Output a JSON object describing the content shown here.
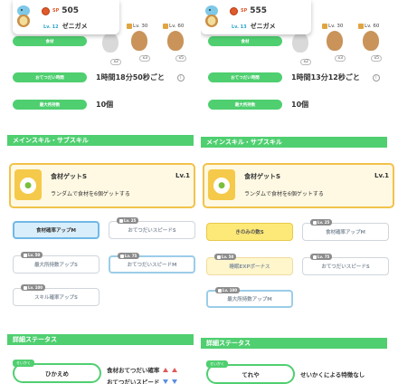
{
  "left": {
    "pokemon": {
      "sp_label": "SP",
      "sp_value": "505",
      "lv": "Lv. 12",
      "name": "ゼニガメ"
    },
    "ingredients": [
      {
        "lv": "Lv. 30",
        "count": "x3"
      },
      {
        "lv": "Lv. 60",
        "count": "x5"
      }
    ],
    "first_count": "x2",
    "rows": [
      {
        "label": "食材",
        "value": ""
      },
      {
        "label": "おてつだい時間",
        "value": "1時間18分50秒ごと"
      },
      {
        "label": "最大所持数",
        "value": "10個"
      }
    ],
    "section_skills": "メインスキル・サブスキル",
    "main_skill": {
      "name": "食材ゲットS",
      "lv": "Lv.1",
      "desc": "ランダムで食材を6個ゲットする"
    },
    "subskills": [
      {
        "lv": "",
        "label": "食材確率アップM"
      },
      {
        "lv": "Lv. 25",
        "label": "おてつだいスピードS"
      },
      {
        "lv": "Lv. 50",
        "label": "最大所持数アップS"
      },
      {
        "lv": "Lv. 75",
        "label": "おてつだいスピードM"
      },
      {
        "lv": "Lv. 100",
        "label": "スキル確率アップS"
      }
    ],
    "section_status": "詳細ステータス",
    "nature": {
      "tag": "せいかく",
      "name": "ひかえめ"
    },
    "nature_stats": [
      "食材おてつだい確率",
      "おてつだいスピード"
    ]
  },
  "right": {
    "pokemon": {
      "sp_label": "SP",
      "sp_value": "555",
      "lv": "Lv. 13",
      "name": "ゼニガメ"
    },
    "ingredients": [
      {
        "lv": "Lv. 30",
        "count": "x3"
      },
      {
        "lv": "Lv. 60",
        "count": "x5"
      }
    ],
    "first_count": "x2",
    "rows": [
      {
        "label": "食材",
        "value": ""
      },
      {
        "label": "おてつだい時間",
        "value": "1時間13分12秒ごと"
      },
      {
        "label": "最大所持数",
        "value": "10個"
      }
    ],
    "section_skills": "メインスキル・サブスキル",
    "main_skill": {
      "name": "食材ゲットS",
      "lv": "Lv.1",
      "desc": "ランダムで食材を6個ゲットする"
    },
    "subskills": [
      {
        "lv": "",
        "label": "きのみの数S"
      },
      {
        "lv": "Lv. 25",
        "label": "食材確率アップM"
      },
      {
        "lv": "Lv. 50",
        "label": "睡眠EXPボーナス"
      },
      {
        "lv": "Lv. 75",
        "label": "おてつだいスピードS"
      },
      {
        "lv": "Lv. 100",
        "label": "最大所持数アップM"
      }
    ],
    "section_status": "詳細ステータス",
    "nature": {
      "tag": "せいかく",
      "name": "てれや"
    },
    "nature_stats": [
      "せいかくによる特徴なし"
    ]
  },
  "colors": {
    "green": "#4fcf70",
    "gold": "#f2c24a",
    "sp": "#e05a2b",
    "blue": "#6fb8e6"
  }
}
